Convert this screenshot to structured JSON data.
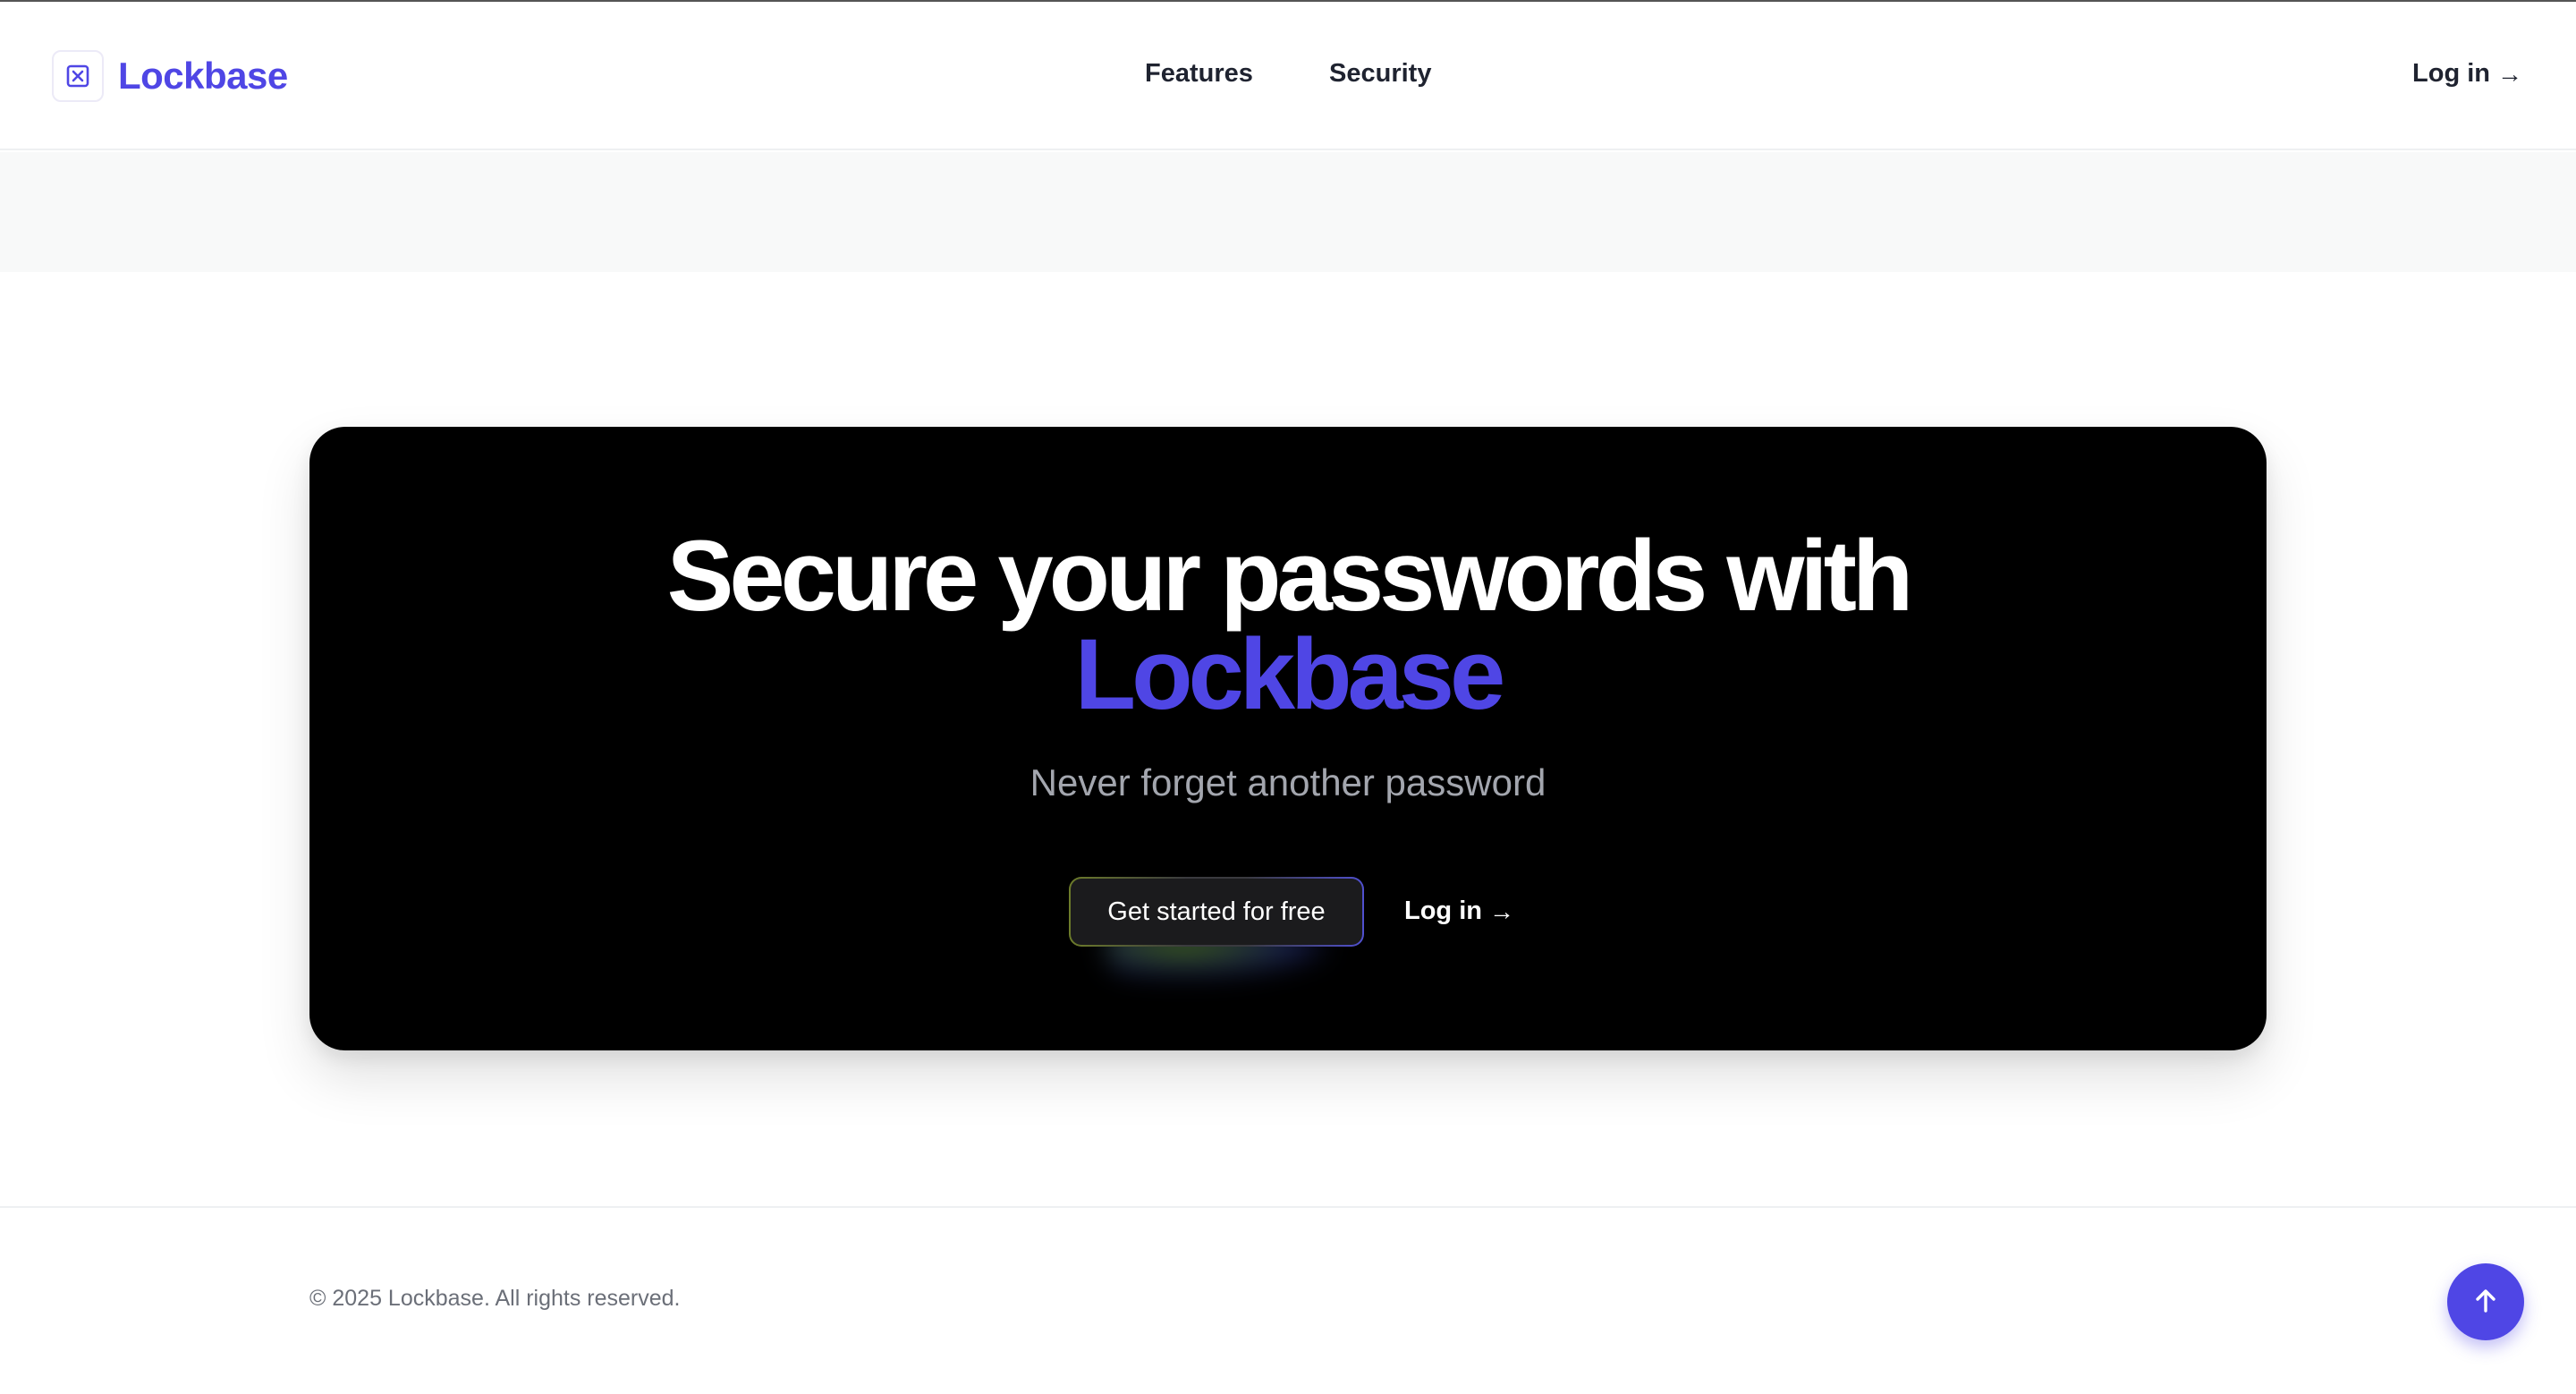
{
  "header": {
    "brand": "Lockbase",
    "nav": [
      {
        "label": "Features"
      },
      {
        "label": "Security"
      }
    ],
    "login_label": "Log in",
    "login_arrow": "→"
  },
  "hero": {
    "title_line1": "Secure your passwords with",
    "title_brand": "Lockbase",
    "subtitle": "Never forget another password",
    "cta_label": "Get started for free",
    "login_label": "Log in",
    "login_arrow": "→"
  },
  "footer": {
    "copyright": "© 2025 Lockbase. All rights reserved."
  },
  "colors": {
    "accent": "#4f46e5",
    "hero_bg": "#000000",
    "band_bg": "#f8f9f9"
  },
  "icons": {
    "logo": "lock-box-icon",
    "login_arrow": "arrow-right-icon",
    "scroll_top": "arrow-up-icon"
  }
}
